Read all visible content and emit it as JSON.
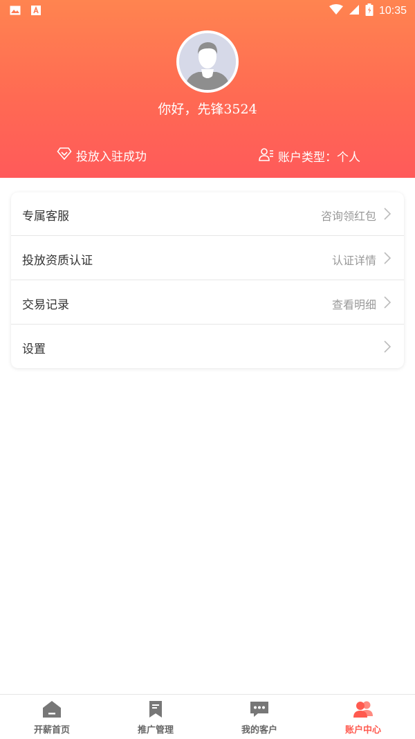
{
  "status_bar": {
    "time": "10:35"
  },
  "profile": {
    "greeting": "你好，先锋3524"
  },
  "info": {
    "placement_status": "投放入驻成功",
    "account_type": "账户类型：个人"
  },
  "menu": [
    {
      "label": "专属客服",
      "value": "咨询领红包"
    },
    {
      "label": "投放资质认证",
      "value": "认证详情"
    },
    {
      "label": "交易记录",
      "value": "查看明细"
    },
    {
      "label": "设置",
      "value": ""
    }
  ],
  "tabs": [
    {
      "label": "开薪首页"
    },
    {
      "label": "推广管理"
    },
    {
      "label": "我的客户"
    },
    {
      "label": "账户中心"
    }
  ],
  "colors": {
    "accent": "#ff5a4f",
    "header_top": "#ff8450",
    "header_bottom": "#ff5a5a"
  }
}
